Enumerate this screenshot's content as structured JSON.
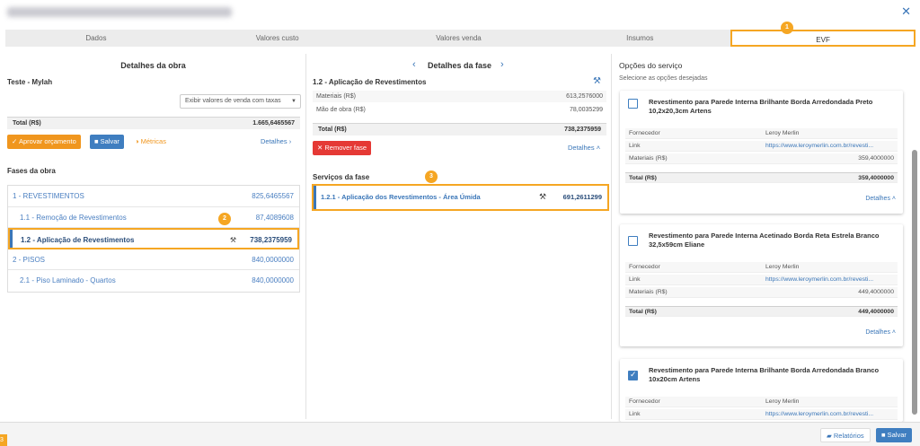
{
  "window": {
    "close_icon": "close-icon"
  },
  "tabs": [
    {
      "label": "Dados"
    },
    {
      "label": "Valores custo"
    },
    {
      "label": "Valores venda"
    },
    {
      "label": "Insumos"
    },
    {
      "label": "EVF",
      "badge": "1"
    }
  ],
  "left": {
    "title": "Detalhes da obra",
    "subtitle": "Teste - Mylah",
    "select_value": "Exibir valores de venda com taxas",
    "total_label": "Total (R$)",
    "total_value": "1.665,6465567",
    "approve_label": "Aprovar orçamento",
    "save_label": "Salvar",
    "metrics_label": "Métricas",
    "details_label": "Detalhes",
    "phases_title": "Fases da obra",
    "phases": [
      {
        "label": "1 - REVESTIMENTOS",
        "value": "825,6465567"
      },
      {
        "label": "1.1 - Remoção de Revestimentos",
        "value": "87,4089608"
      },
      {
        "label": "1.2 - Aplicação de Revestimentos",
        "value": "738,2375959",
        "badge": "2"
      },
      {
        "label": "2 - PISOS",
        "value": "840,0000000"
      },
      {
        "label": "2.1 - Piso Laminado - Quartos",
        "value": "840,0000000"
      }
    ]
  },
  "middle": {
    "title": "Detalhes da fase",
    "phase_name": "1.2 - Aplicação de Revestimentos",
    "materials_label": "Materiais (R$)",
    "materials_value": "613,2576000",
    "labor_label": "Mão de obra (R$)",
    "labor_value": "78,0035299",
    "total_label": "Total (R$)",
    "total_value": "738,2375959",
    "remove_label": "Remover fase",
    "details_label": "Detalhes",
    "services_title": "Serviços da fase",
    "services_badge": "3",
    "service_label": "1.2.1 - Aplicação dos Revestimentos - Área Úmida",
    "service_value": "691,2611299"
  },
  "right": {
    "title": "Opções do serviço",
    "subtitle": "Selecione as opções desejadas",
    "options": [
      {
        "title": "Revestimento para Parede Interna Brilhante Borda Arredondada Preto 10,2x20,3cm Artens",
        "checked": false,
        "supplier_label": "Fornecedor",
        "supplier_value": "Leroy Merlin",
        "link_label": "Link",
        "link_value": "https://www.leroymerlin.com.br/revesti...",
        "materials_label": "Materiais (R$)",
        "materials_value": "359,4000000",
        "total_label": "Total (R$)",
        "total_value": "359,4000000",
        "details_label": "Detalhes"
      },
      {
        "title": "Revestimento para Parede Interna Acetinado Borda Reta Estrela Branco 32,5x59cm Eliane",
        "checked": false,
        "supplier_label": "Fornecedor",
        "supplier_value": "Leroy Merlin",
        "link_label": "Link",
        "link_value": "https://www.leroymerlin.com.br/revesti...",
        "materials_label": "Materiais (R$)",
        "materials_value": "449,4000000",
        "total_label": "Total (R$)",
        "total_value": "449,4000000",
        "details_label": "Detalhes"
      },
      {
        "title": "Revestimento para Parede Interna Brilhante Borda Arredondada Branco 10x20cm Artens",
        "checked": true,
        "supplier_label": "Fornecedor",
        "supplier_value": "Leroy Merlin",
        "link_label": "Link",
        "link_value": "https://www.leroymerlin.com.br/revesti..."
      }
    ]
  },
  "footer": {
    "reports_label": "Relatórios",
    "save_label": "Salvar",
    "corner_badge": "3"
  },
  "colors": {
    "accent": "#f5a623",
    "primary": "#3f7ec0",
    "danger": "#e53935",
    "approve": "#f0961e"
  }
}
